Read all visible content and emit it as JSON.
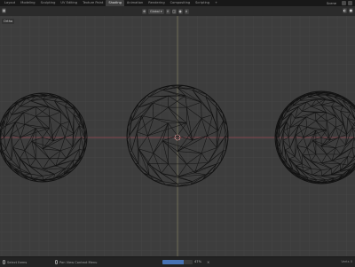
{
  "workspace_tabs": [
    {
      "label": "Layout",
      "active": false
    },
    {
      "label": "Modeling",
      "active": false
    },
    {
      "label": "Sculpting",
      "active": false
    },
    {
      "label": "UV Editing",
      "active": false
    },
    {
      "label": "Texture Paint",
      "active": false
    },
    {
      "label": "Shading",
      "active": true
    },
    {
      "label": "Animation",
      "active": false
    },
    {
      "label": "Rendering",
      "active": false
    },
    {
      "label": "Compositing",
      "active": false
    },
    {
      "label": "Scripting",
      "active": false
    },
    {
      "label": "+",
      "active": false
    }
  ],
  "top_right": {
    "scene_label": "Scene"
  },
  "viewport_header": {
    "orientation_label": "Global",
    "snap_icon": "magnet-icon",
    "proportional_icon": "circle-dot-icon"
  },
  "viewport": {
    "view_label": "Ortho",
    "colors": {
      "background": "#3d3d3d",
      "grid": "#474747",
      "x_axis": "#9a4a55",
      "y_axis": "#b8b07a",
      "wire": "#121212"
    },
    "objects": [
      "icosphere-left",
      "icosphere-center",
      "icosphere-right"
    ]
  },
  "statusbar": {
    "left_text": "Select Items",
    "mid_text": "Pan View  Context Menu",
    "progress_fraction": 0.72,
    "progress_text": "47%",
    "right_text": "Verts 0"
  }
}
